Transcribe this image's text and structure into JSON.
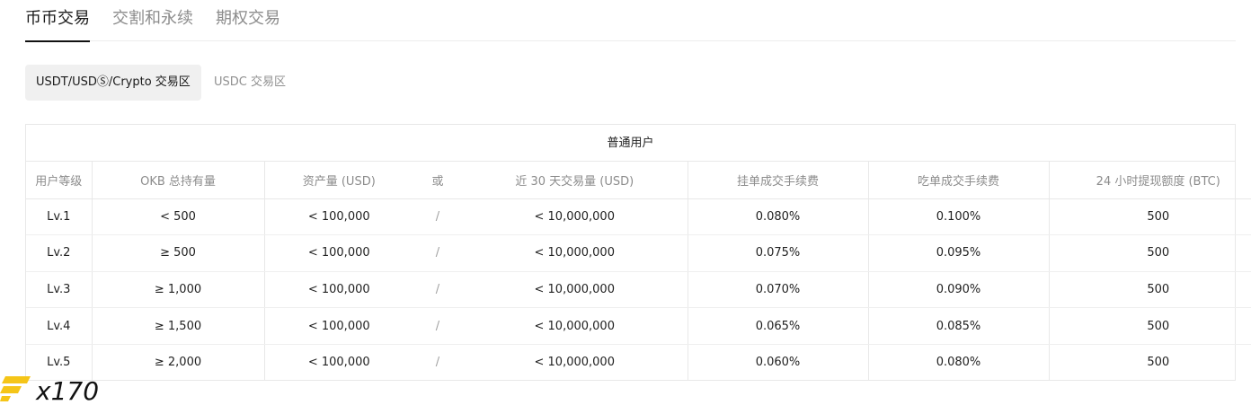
{
  "tabs": [
    {
      "label": "币币交易",
      "active": true
    },
    {
      "label": "交割和永续",
      "active": false
    },
    {
      "label": "期权交易",
      "active": false
    }
  ],
  "subtabs": [
    {
      "label": "USDT/USDⓈ/Crypto 交易区",
      "active": true
    },
    {
      "label": "USDC 交易区",
      "active": false
    }
  ],
  "table": {
    "title": "普通用户",
    "headers": {
      "level": "用户等级",
      "okb": "OKB 总持有量",
      "asset": "资产量 (USD)",
      "or": "或",
      "volume": "近 30 天交易量 (USD)",
      "maker": "挂单成交手续费",
      "taker": "吃单成交手续费",
      "withdraw": "24 小时提现额度 (BTC)"
    },
    "rows": [
      {
        "level": "Lv.1",
        "okb": "< 500",
        "asset": "< 100,000",
        "sep": "/",
        "volume": "< 10,000,000",
        "maker": "0.080%",
        "taker": "0.100%",
        "withdraw": "500"
      },
      {
        "level": "Lv.2",
        "okb": "≥ 500",
        "asset": "< 100,000",
        "sep": "/",
        "volume": "< 10,000,000",
        "maker": "0.075%",
        "taker": "0.095%",
        "withdraw": "500"
      },
      {
        "level": "Lv.3",
        "okb": "≥ 1,000",
        "asset": "< 100,000",
        "sep": "/",
        "volume": "< 10,000,000",
        "maker": "0.070%",
        "taker": "0.090%",
        "withdraw": "500"
      },
      {
        "level": "Lv.4",
        "okb": "≥ 1,500",
        "asset": "< 100,000",
        "sep": "/",
        "volume": "< 10,000,000",
        "maker": "0.065%",
        "taker": "0.085%",
        "withdraw": "500"
      },
      {
        "level": "Lv.5",
        "okb": "≥ 2,000",
        "asset": "< 100,000",
        "sep": "/",
        "volume": "< 10,000,000",
        "maker": "0.060%",
        "taker": "0.080%",
        "withdraw": "500"
      }
    ]
  },
  "watermark": {
    "text": "x170",
    "color": "#f5c518"
  }
}
